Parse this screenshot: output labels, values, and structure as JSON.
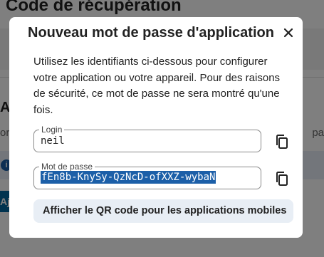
{
  "background": {
    "title": "Code de récupération",
    "heading_fragment": "Au",
    "text_left_fragment": "or",
    "text_right_fragment": "pa",
    "info_icon": "info-icon",
    "button_fragment": "Aj"
  },
  "dialog": {
    "title": "Nouveau mot de passe d'application",
    "close_icon": "close-icon",
    "description": "Utilisez les identifiants ci-dessous pour configurer votre application ou votre appareil. Pour des raisons de sécurité, ce mot de passe ne sera montré qu'une fois.",
    "login": {
      "label": "Login",
      "value": "neil",
      "copy_icon": "copy-icon"
    },
    "password": {
      "label": "Mot de passe",
      "value": "fEn8b-KnySy-QzNcD-ofXXZ-wybaN",
      "copy_icon": "copy-icon"
    },
    "qr_button_label": "Afficher le QR code pour les applications mobiles"
  },
  "colors": {
    "selection": "#1c5fa8",
    "qr_button_bg": "#e8eef5",
    "overlay": "rgba(0,0,0,0.5)"
  }
}
